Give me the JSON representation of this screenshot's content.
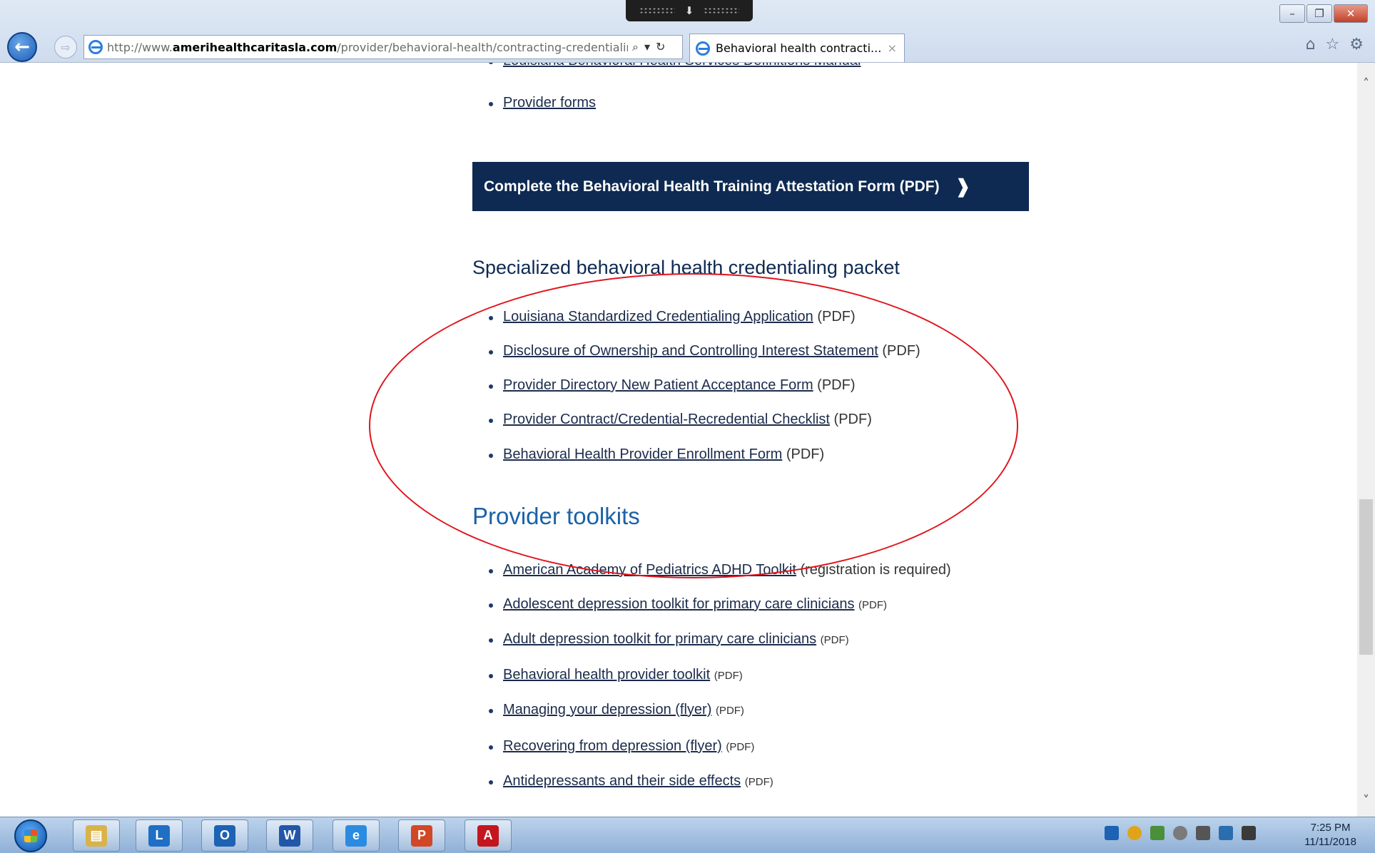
{
  "browser": {
    "url_prefix": "http://www.",
    "url_host": "amerihealthcaritasla.com",
    "url_path": "/provider/behavioral-health/contracting-credentialing",
    "tab_title": "Behavioral health contracti...",
    "tab_close": "×",
    "search_glyph": "⌕",
    "dropdown_glyph": "▾",
    "refresh_glyph": "↻",
    "back_glyph": "←",
    "forward_glyph": "⇨",
    "home_glyph": "⌂",
    "favorites_glyph": "☆",
    "tools_glyph": "⚙",
    "minimize_glyph": "–",
    "maximize_glyph": "❐",
    "close_glyph": "✕"
  },
  "top_links": [
    {
      "text": "Louisiana Behavioral Health Services Definitions Manual"
    },
    {
      "text": "Provider forms"
    }
  ],
  "cta": {
    "label": "Complete the Behavioral Health Training Attestation Form (PDF)",
    "chevron": "❱"
  },
  "credentialing": {
    "heading": "Specialized behavioral health credentialing packet",
    "items": [
      {
        "link": "Louisiana Standardized Credentialing Application",
        "suffix": "(PDF)"
      },
      {
        "link": "Disclosure of Ownership and Controlling Interest Statement",
        "suffix": "(PDF)"
      },
      {
        "link": "Provider Directory New Patient Acceptance Form",
        "suffix": "(PDF)"
      },
      {
        "link": "Provider Contract/Credential-Recredential Checklist",
        "suffix": "(PDF)"
      },
      {
        "link": "Behavioral Health Provider Enrollment Form",
        "suffix": "(PDF)"
      }
    ]
  },
  "toolkits": {
    "heading": "Provider toolkits",
    "items": [
      {
        "link": "American Academy of Pediatrics ADHD Toolkit",
        "suffix": "(registration is required)"
      },
      {
        "link": "Adolescent depression toolkit for primary care clinicians",
        "suffix": "(PDF)"
      },
      {
        "link": "Adult depression toolkit for primary care clinicians",
        "suffix": "(PDF)"
      },
      {
        "link": "Behavioral health provider toolkit",
        "suffix": "(PDF)"
      },
      {
        "link": "Managing your depression (flyer)",
        "suffix": "(PDF)"
      },
      {
        "link": "Recovering from depression (flyer)",
        "suffix": "(PDF)"
      },
      {
        "link": "Antidepressants and their side effects",
        "suffix": "(PDF)"
      }
    ]
  },
  "scrollbar": {
    "up_glyph": "˄",
    "down_glyph": "˅"
  },
  "taskbar": {
    "apps": [
      {
        "name": "file-manager",
        "glyph": "▤",
        "color": "#d9b24a"
      },
      {
        "name": "lync",
        "glyph": "L",
        "color": "#1f6fc4"
      },
      {
        "name": "outlook",
        "glyph": "O",
        "color": "#1d62b3"
      },
      {
        "name": "word",
        "glyph": "W",
        "color": "#2257a8"
      },
      {
        "name": "internet-explorer",
        "glyph": "e",
        "color": "#2b8be0"
      },
      {
        "name": "powerpoint",
        "glyph": "P",
        "color": "#d24726"
      },
      {
        "name": "acrobat",
        "glyph": "A",
        "color": "#c4161c"
      }
    ],
    "time": "7:25 PM",
    "date": "11/11/2018"
  }
}
